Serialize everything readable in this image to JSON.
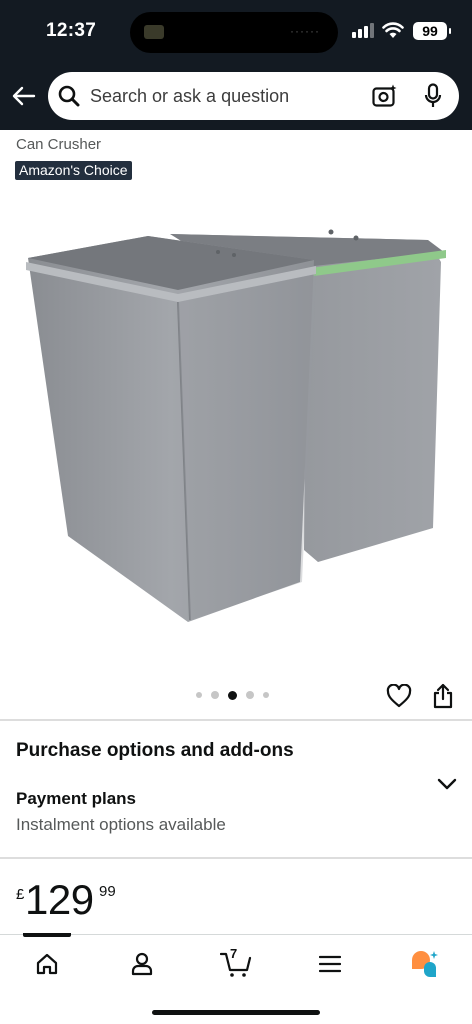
{
  "status_bar": {
    "time": "12:37",
    "battery": "99"
  },
  "search": {
    "placeholder": "Search or ask a question"
  },
  "product": {
    "title_line2": "Can Crusher",
    "badge": "Amazon's Choice",
    "image_alt": "Two grey recycling bins",
    "carousel": {
      "count": 5,
      "active_index": 2
    }
  },
  "purchase_section": {
    "title": "Purchase options and add-ons",
    "payment_title": "Payment plans",
    "payment_subtitle": "Instalment options available"
  },
  "price": {
    "symbol": "£",
    "whole": "129",
    "fraction": "99"
  },
  "bottom_nav": {
    "cart_count": "7",
    "items": [
      "home-icon",
      "account-icon",
      "cart-icon",
      "menu-icon",
      "rufus-icon"
    ]
  },
  "colors": {
    "header_bg": "#131a22",
    "badge_bg": "#232f3e",
    "rufus_orange": "#ff8f40",
    "rufus_teal": "#1fa5c9"
  }
}
